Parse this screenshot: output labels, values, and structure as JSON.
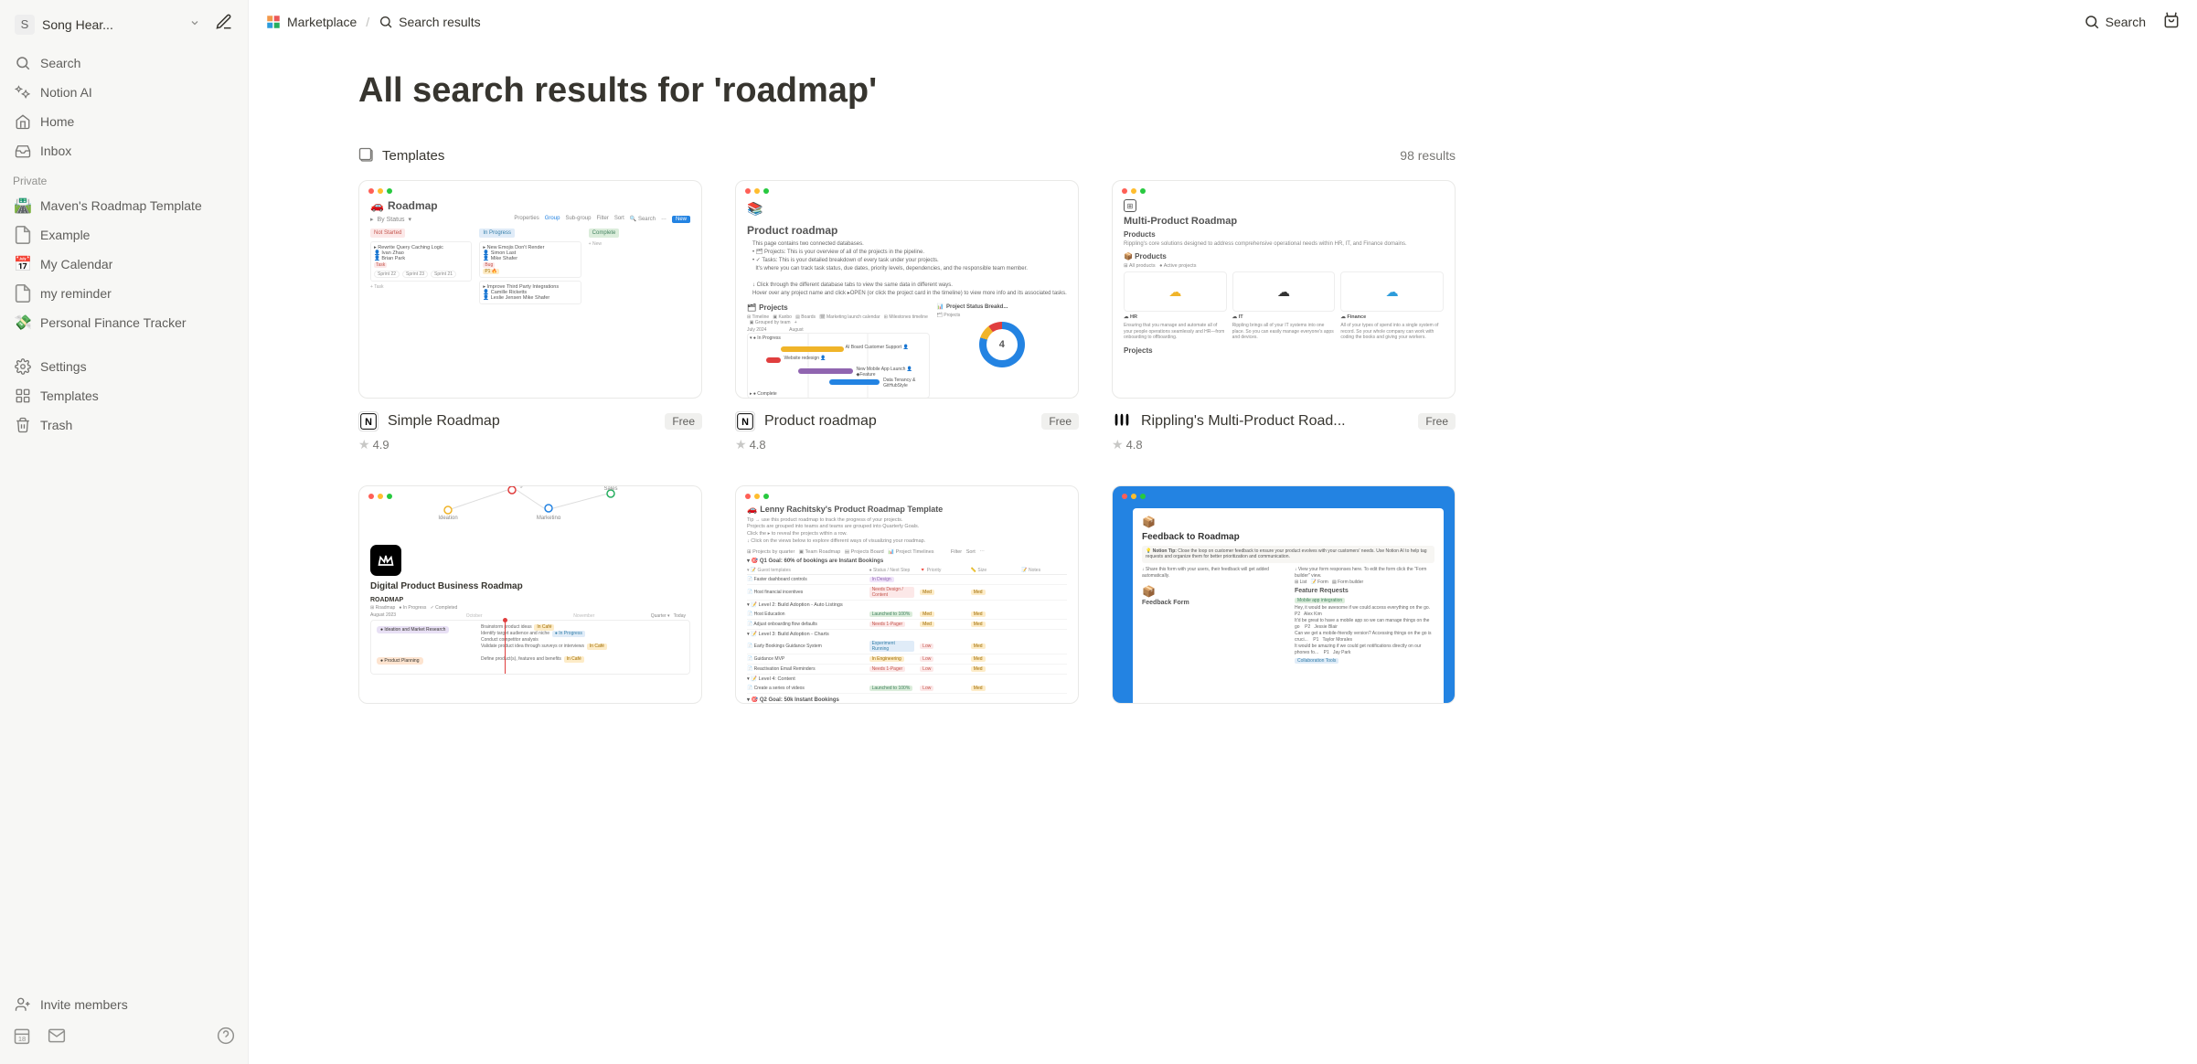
{
  "workspace": {
    "initial": "S",
    "name": "Song Hear..."
  },
  "sidebar": {
    "nav": [
      {
        "label": "Search"
      },
      {
        "label": "Notion AI"
      },
      {
        "label": "Home"
      },
      {
        "label": "Inbox"
      }
    ],
    "private_label": "Private",
    "pages": [
      {
        "emoji": "🛣️",
        "label": "Maven's Roadmap Template"
      },
      {
        "emoji": "",
        "label": "Example"
      },
      {
        "emoji": "📅",
        "label": "My Calendar"
      },
      {
        "emoji": "",
        "label": "my reminder"
      },
      {
        "emoji": "💸",
        "label": "Personal Finance Tracker"
      }
    ],
    "bottom": [
      {
        "label": "Settings"
      },
      {
        "label": "Templates"
      },
      {
        "label": "Trash"
      }
    ],
    "invite": "Invite members"
  },
  "breadcrumb": {
    "marketplace": "Marketplace",
    "results": "Search results"
  },
  "topbar": {
    "search": "Search"
  },
  "page": {
    "title": "All search results for 'roadmap'",
    "section": "Templates",
    "count": "98 results"
  },
  "cards": [
    {
      "title": "Simple Roadmap",
      "badge": "Free",
      "rating": "4.9",
      "brand": "notion"
    },
    {
      "title": "Product roadmap",
      "badge": "Free",
      "rating": "4.8",
      "brand": "notion"
    },
    {
      "title": "Rippling's Multi-Product Road...",
      "badge": "Free",
      "rating": "4.8",
      "brand": "rippling"
    },
    {
      "title": "",
      "badge": "",
      "rating": "",
      "brand": ""
    },
    {
      "title": "",
      "badge": "",
      "rating": "",
      "brand": ""
    },
    {
      "title": "",
      "badge": "",
      "rating": "",
      "brand": ""
    }
  ],
  "thumbnails": {
    "t1": {
      "title": "Roadmap",
      "by_status": "By Status",
      "tools": [
        "Properties",
        "Group",
        "Sub-group",
        "Filter",
        "Sort",
        "Search"
      ],
      "new": "New",
      "cols": [
        "Not Started",
        "In Progress",
        "Complete"
      ],
      "cards_ns": [
        "Rewrite Query Caching Logic",
        "Ivan Zhao",
        "Brian Park"
      ],
      "cards_ip": [
        "New Emojis Don't Render",
        "Simon Last",
        "Mike Shafer",
        "Improve Third Party Integrations",
        "Camille Ricketts",
        "Leslie Jensen   Mike Shafer"
      ],
      "sprints": [
        "Sprint 22",
        "Sprint 23",
        "Sprint 21"
      ]
    },
    "t2": {
      "title": "Product roadmap",
      "projects": "Projects",
      "status": "Project Status Breakd...",
      "donut": "4"
    },
    "t3": {
      "title": "Multi-Product Roadmap",
      "sub": "Products",
      "all": "All products",
      "caption": "Rippling's core solutions designed to address comprehensive operational needs within HR, IT, and Finance domains.",
      "proj": "Projects"
    },
    "t4": {
      "title": "Digital Product Business Roadmap",
      "rm": "ROADMAP",
      "date": "August 2023"
    },
    "t5": {
      "title": "Lenny Rachitsky's Product Roadmap Template"
    },
    "t6": {
      "title": "Feedback to Roadmap",
      "sub1": "Feature Requests",
      "sub2": "Feedback Form"
    }
  }
}
